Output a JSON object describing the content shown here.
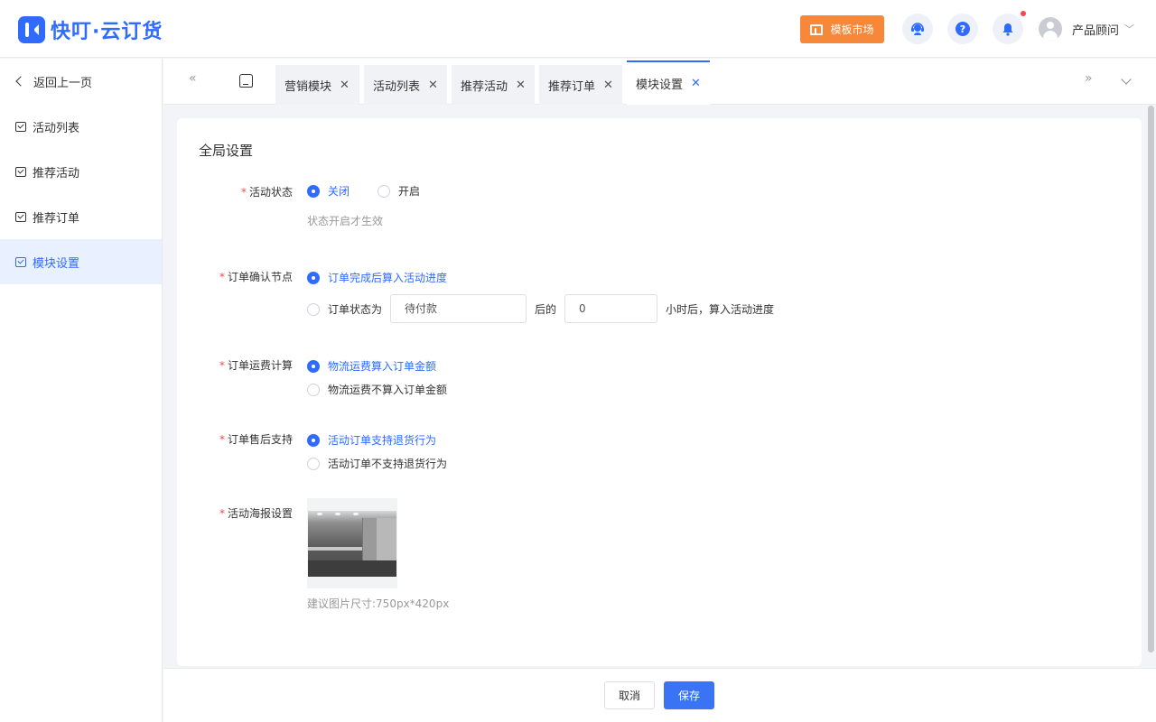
{
  "app": {
    "logo_text": "快叮·云订货"
  },
  "header": {
    "template_market_label": "模板市场",
    "help_glyph": "?",
    "user_name": "产品顾问",
    "icons": [
      "support-agent-icon",
      "help-icon",
      "bell-icon"
    ]
  },
  "sidebar": {
    "back_label": "返回上一页",
    "items": [
      {
        "label": "活动列表",
        "active": false
      },
      {
        "label": "推荐活动",
        "active": false
      },
      {
        "label": "推荐订单",
        "active": false
      },
      {
        "label": "模块设置",
        "active": true
      }
    ]
  },
  "tabs": [
    {
      "label": "营销模块",
      "active": false
    },
    {
      "label": "活动列表",
      "active": false
    },
    {
      "label": "推荐活动",
      "active": false
    },
    {
      "label": "推荐订单",
      "active": false
    },
    {
      "label": "模块设置",
      "active": true
    }
  ],
  "tab_close_glyph": "✕",
  "form": {
    "title": "全局设置",
    "required_mark": "*",
    "activity_status": {
      "label": "活动状态",
      "options": [
        "关闭",
        "开启"
      ],
      "selected": "关闭",
      "hint": "状态开启才生效"
    },
    "order_confirm": {
      "label": "订单确认节点",
      "option_1": "订单完成后算入活动进度",
      "option_2_prefix": "订单状态为",
      "status_value": "待付款",
      "after_label": "后的",
      "hours_value": "0",
      "suffix": "小时后，算入活动进度",
      "selected": 1
    },
    "freight": {
      "label": "订单运费计算",
      "options": [
        "物流运费算入订单金额",
        "物流运费不算入订单金额"
      ],
      "selected": 1
    },
    "after_sale": {
      "label": "订单售后支持",
      "options": [
        "活动订单支持退货行为",
        "活动订单不支持退货行为"
      ],
      "selected": 1
    },
    "poster": {
      "label": "活动海报设置",
      "hint": "建议图片尺寸:750px*420px"
    }
  },
  "footer": {
    "cancel_label": "取消",
    "save_label": "保存"
  },
  "colors": {
    "brand": "#2f6bff",
    "accent_orange": "#f7883a",
    "required": "#f5484d"
  }
}
